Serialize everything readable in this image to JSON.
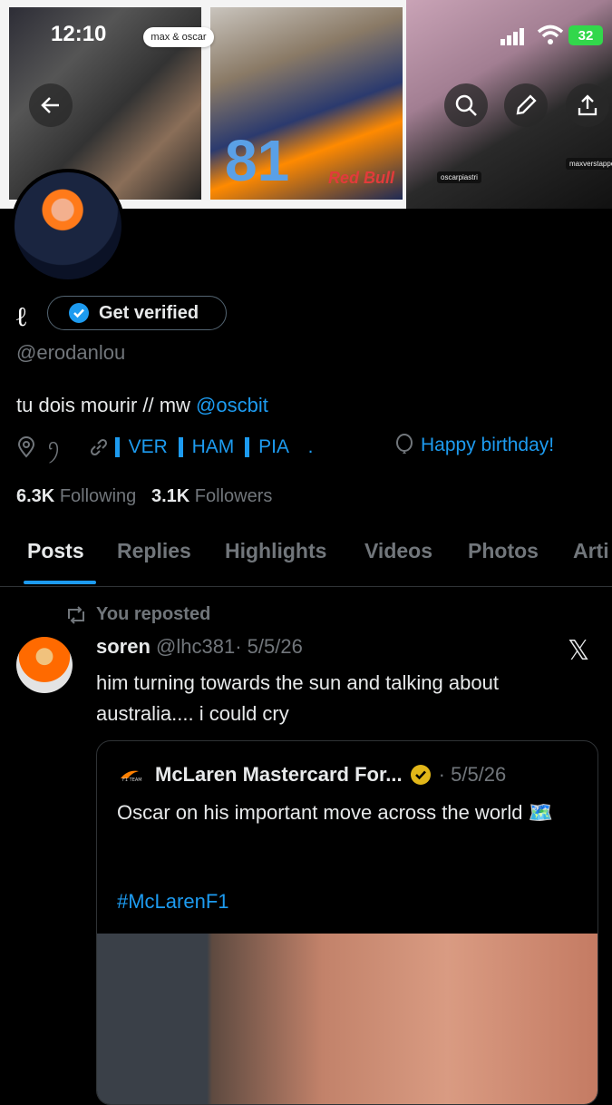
{
  "status_bar": {
    "time": "12:10",
    "battery": "32"
  },
  "banner": {
    "sticker_text": "max & oscar",
    "car_number": "81",
    "sponsor": "Red Bull",
    "tag_1": "oscarpiastri",
    "tag_2": "maxverstappen"
  },
  "profile": {
    "logo_char": "ℓ",
    "verify_label": "Get verified",
    "handle": "@erodanlou",
    "bio_text": "tu dois mourir // mw ",
    "bio_mention": "@oscbit",
    "location_suffix": "ꪆ",
    "link_items": [
      "VER",
      "HAM",
      "PIA",
      "."
    ],
    "birthday": "Happy birthday!",
    "following_count": "6.3K",
    "following_label": "Following",
    "followers_count": "3.1K",
    "followers_label": "Followers"
  },
  "tabs": [
    "Posts",
    "Replies",
    "Highlights",
    "Videos",
    "Photos",
    "Arti"
  ],
  "post": {
    "repost_label": "You reposted",
    "author_name": "soren",
    "author_handle": "@lhc381",
    "date": "· 5/5/26",
    "text": "him turning towards the sun and talking about australia.... i could cry",
    "quote": {
      "author_name": "McLaren Mastercard For...",
      "date": "· 5/5/26",
      "text": "Oscar on his important move across the world 🗺️",
      "hashtag": "#McLarenF1"
    }
  },
  "colors": {
    "accent": "#1d9bf0",
    "muted": "#71767b",
    "background": "#000000",
    "verified_gold": "#e2b719"
  }
}
